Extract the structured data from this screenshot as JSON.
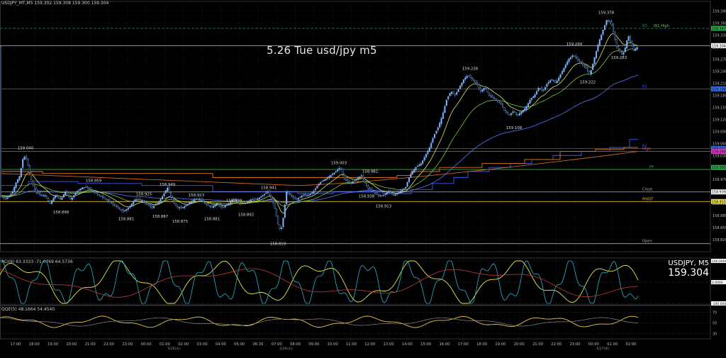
{
  "header": {
    "symbol_line": "USDJPY_MT,M5  159.302 159.308 159.300 159.304",
    "rci_line": "RCI(9) 63.3333 -71.0769 64.5736",
    "qqe_line": "QQE(5) 48.1664 54.4540"
  },
  "annotation": {
    "title": "5.26 Tue usd/jpy m5"
  },
  "symbol_box": {
    "name": "USDJPY, M5",
    "price": "159.304"
  },
  "colors": {
    "background": "#000000",
    "candle": "#7fb4ff",
    "grid": "#1a2a3a",
    "ma_fast": "#d8e86a",
    "ma_mid": "#7bc63a",
    "ma_slow": "#4d6ae0",
    "step_blue": "#3d5cf0",
    "step_orange": "#e07a1a",
    "pivot": "#e8c040",
    "rci_yellow": "#e8e84a",
    "rci_teal": "#2ab3c8",
    "rci_red": "#c03a3a",
    "qqe_yellow": "#e8c84a",
    "qqe_gray": "#888888"
  },
  "chart_data": [
    {
      "type": "candlestick",
      "title": "USDJPY_MT,M5",
      "ylim": [
        158.79,
        159.4
      ],
      "y_ticks": [
        "159.390",
        "159.360",
        "159.330",
        "159.300",
        "159.270",
        "159.240",
        "159.210",
        "159.180",
        "159.150",
        "159.120",
        "159.090",
        "159.060",
        "159.030",
        "159.000",
        "158.970",
        "158.940",
        "158.910",
        "158.880",
        "158.850",
        "158.820"
      ],
      "x_ticks": [
        "17:00",
        "18:00",
        "19:00",
        "20:00",
        "21:00",
        "22:00",
        "23:00",
        "00:00",
        "01:00",
        "02:00",
        "03:00",
        "04:00",
        "05:00",
        "06:30",
        "07:00",
        "08:00",
        "09:00",
        "10:00",
        "11:00",
        "12:00",
        "13:00",
        "14:00",
        "15:00",
        "16:00",
        "17:00",
        "18:00",
        "19:00",
        "20:00",
        "21:00",
        "22:00",
        "23:00",
        "00:00",
        "01:00",
        "02:00"
      ],
      "date_labels": [
        "5/26(火)",
        "5/26(火)",
        "5/27(水)"
      ],
      "close_path": [
        [
          0,
          158.93
        ],
        [
          8,
          158.92
        ],
        [
          14,
          158.93
        ],
        [
          18,
          158.94
        ],
        [
          22,
          158.96
        ],
        [
          28,
          158.98
        ],
        [
          32,
          159.02
        ],
        [
          36,
          159.03
        ],
        [
          40,
          159.0
        ],
        [
          44,
          158.97
        ],
        [
          50,
          158.94
        ],
        [
          58,
          158.93
        ],
        [
          64,
          158.93
        ],
        [
          70,
          158.91
        ],
        [
          78,
          158.93
        ],
        [
          86,
          158.92
        ],
        [
          92,
          158.94
        ],
        [
          100,
          158.92
        ],
        [
          108,
          158.94
        ],
        [
          116,
          158.95
        ],
        [
          124,
          158.95
        ],
        [
          132,
          158.94
        ],
        [
          140,
          158.93
        ],
        [
          150,
          158.92
        ],
        [
          158,
          158.91
        ],
        [
          166,
          158.9
        ],
        [
          174,
          158.89
        ],
        [
          182,
          158.9
        ],
        [
          190,
          158.92
        ],
        [
          198,
          158.92
        ],
        [
          206,
          158.91
        ],
        [
          214,
          158.9
        ],
        [
          222,
          158.91
        ],
        [
          230,
          158.93
        ],
        [
          236,
          158.95
        ],
        [
          242,
          158.92
        ],
        [
          250,
          158.9
        ],
        [
          258,
          158.9
        ],
        [
          266,
          158.91
        ],
        [
          274,
          158.92
        ],
        [
          282,
          158.92
        ],
        [
          290,
          158.91
        ],
        [
          298,
          158.9
        ],
        [
          306,
          158.91
        ],
        [
          314,
          158.9
        ],
        [
          322,
          158.91
        ],
        [
          330,
          158.92
        ],
        [
          338,
          158.91
        ],
        [
          346,
          158.91
        ],
        [
          354,
          158.92
        ],
        [
          362,
          158.92
        ],
        [
          370,
          158.93
        ],
        [
          378,
          158.94
        ],
        [
          386,
          158.91
        ],
        [
          392,
          158.86
        ],
        [
          396,
          158.84
        ],
        [
          400,
          158.88
        ],
        [
          404,
          158.94
        ],
        [
          410,
          158.93
        ],
        [
          418,
          158.92
        ],
        [
          426,
          158.93
        ],
        [
          434,
          158.93
        ],
        [
          442,
          158.94
        ],
        [
          450,
          158.96
        ],
        [
          458,
          158.97
        ],
        [
          466,
          158.98
        ],
        [
          474,
          158.99
        ],
        [
          480,
          159.0
        ],
        [
          486,
          158.97
        ],
        [
          494,
          158.96
        ],
        [
          502,
          158.97
        ],
        [
          510,
          158.98
        ],
        [
          518,
          158.95
        ],
        [
          526,
          158.94
        ],
        [
          534,
          158.93
        ],
        [
          540,
          158.93
        ],
        [
          548,
          158.94
        ],
        [
          556,
          158.93
        ],
        [
          564,
          158.94
        ],
        [
          572,
          158.95
        ],
        [
          578,
          158.98
        ],
        [
          586,
          159.0
        ],
        [
          594,
          159.01
        ],
        [
          600,
          159.03
        ],
        [
          606,
          159.05
        ],
        [
          612,
          159.08
        ],
        [
          618,
          159.1
        ],
        [
          624,
          159.13
        ],
        [
          630,
          159.17
        ],
        [
          636,
          159.19
        ],
        [
          642,
          159.18
        ],
        [
          648,
          159.2
        ],
        [
          654,
          159.22
        ],
        [
          660,
          159.23
        ],
        [
          666,
          159.22
        ],
        [
          672,
          159.21
        ],
        [
          678,
          159.19
        ],
        [
          684,
          159.2
        ],
        [
          690,
          159.18
        ],
        [
          698,
          159.17
        ],
        [
          706,
          159.16
        ],
        [
          712,
          159.14
        ],
        [
          718,
          159.13
        ],
        [
          724,
          159.14
        ],
        [
          730,
          159.13
        ],
        [
          736,
          159.14
        ],
        [
          742,
          159.15
        ],
        [
          748,
          159.17
        ],
        [
          754,
          159.18
        ],
        [
          760,
          159.2
        ],
        [
          766,
          159.19
        ],
        [
          772,
          159.21
        ],
        [
          778,
          159.22
        ],
        [
          784,
          159.21
        ],
        [
          790,
          159.23
        ],
        [
          796,
          159.25
        ],
        [
          802,
          159.27
        ],
        [
          808,
          159.28
        ],
        [
          814,
          159.27
        ],
        [
          820,
          159.26
        ],
        [
          826,
          159.25
        ],
        [
          832,
          159.23
        ],
        [
          838,
          159.27
        ],
        [
          844,
          159.31
        ],
        [
          850,
          159.34
        ],
        [
          856,
          159.37
        ],
        [
          862,
          159.36
        ],
        [
          866,
          159.33
        ],
        [
          870,
          159.3
        ],
        [
          874,
          159.29
        ],
        [
          878,
          159.28
        ],
        [
          882,
          159.3
        ],
        [
          886,
          159.33
        ],
        [
          890,
          159.31
        ],
        [
          894,
          159.29
        ],
        [
          898,
          159.3
        ]
      ],
      "price_labels": [
        {
          "bar": 36,
          "value": "159.040",
          "pos": "above"
        },
        {
          "bar": 86,
          "value": "158.898",
          "pos": "below"
        },
        {
          "bar": 132,
          "value": "158.959",
          "pos": "above"
        },
        {
          "bar": 178,
          "value": "158.881",
          "pos": "below"
        },
        {
          "bar": 203,
          "value": "158.925",
          "pos": "above"
        },
        {
          "bar": 226,
          "value": "158.887",
          "pos": "below"
        },
        {
          "bar": 236,
          "value": "158.949",
          "pos": "above"
        },
        {
          "bar": 254,
          "value": "158.875",
          "pos": "below"
        },
        {
          "bar": 277,
          "value": "158.923",
          "pos": "above"
        },
        {
          "bar": 299,
          "value": "158.881",
          "pos": "below"
        },
        {
          "bar": 330,
          "value": "158.909",
          "pos": "above"
        },
        {
          "bar": 347,
          "value": "158.892",
          "pos": "below"
        },
        {
          "bar": 379,
          "value": "158.941",
          "pos": "above"
        },
        {
          "bar": 392,
          "value": "158.819",
          "pos": "below"
        },
        {
          "bar": 478,
          "value": "159.003",
          "pos": "above"
        },
        {
          "bar": 517,
          "value": "158.938",
          "pos": "below"
        },
        {
          "bar": 522,
          "value": "158.982",
          "pos": "above"
        },
        {
          "bar": 541,
          "value": "158.913",
          "pos": "below"
        },
        {
          "bar": 663,
          "value": "159.238",
          "pos": "above"
        },
        {
          "bar": 725,
          "value": "159.108",
          "pos": "below"
        },
        {
          "bar": 810,
          "value": "159.299",
          "pos": "above"
        },
        {
          "bar": 829,
          "value": "159.222",
          "pos": "below"
        },
        {
          "bar": 855,
          "value": "159.378",
          "pos": "above"
        },
        {
          "bar": 873,
          "value": "159.283",
          "pos": "below"
        }
      ],
      "levels": [
        {
          "name": "R3",
          "value": 159.347,
          "color": "#2a8a6a"
        },
        {
          "name": "W1 High",
          "value": 159.347,
          "color": "#7bc63a"
        },
        {
          "name": "R2",
          "value": 159.196,
          "color": "#3d5cf0"
        },
        {
          "name": "R1",
          "value": 159.047,
          "color": "#3d5cf0"
        },
        {
          "name": "High",
          "value": 159.04,
          "color": "#c84ab0"
        },
        {
          "name": "PP",
          "value": 158.995,
          "color": "#3db03d"
        },
        {
          "name": "Close",
          "value": 158.939,
          "color": "#aaaaaa"
        },
        {
          "name": "PIVOT",
          "value": 158.915,
          "color": "#e8c040"
        },
        {
          "name": "Open",
          "value": 158.81,
          "color": "#aaaaaa"
        }
      ],
      "axis_tags": [
        {
          "label": "W1 High",
          "value": "159.347",
          "color": "#2ea84a"
        },
        {
          "label": "price",
          "value": "159.304",
          "color": "#ffffff"
        },
        {
          "label": "R2",
          "value": "159.196",
          "color": "#3a6ee0"
        },
        {
          "label": "R1",
          "value": "159.047",
          "color": "#3a6ee0"
        },
        {
          "label": "High",
          "value": "159.040",
          "color": "#d040c0"
        },
        {
          "label": "PP",
          "value": "159.000",
          "color": "#2ea84a"
        },
        {
          "label": "Close",
          "value": "158.939",
          "color": "#ffffff"
        },
        {
          "label": "PIVOT",
          "value": "158.915",
          "color": "#e8e040"
        }
      ]
    },
    {
      "type": "line",
      "title": "RCI(9) 63.3333 -71.0769 64.5736",
      "ylim": [
        -100,
        100
      ],
      "y_ticks": [
        "100.0000",
        "0.0000",
        "-100.0000"
      ]
    },
    {
      "type": "line",
      "title": "QQE(5) 48.1664 54.4540",
      "ylim": [
        20,
        80
      ],
      "y_ticks": [
        "70",
        "50",
        "30"
      ]
    }
  ]
}
